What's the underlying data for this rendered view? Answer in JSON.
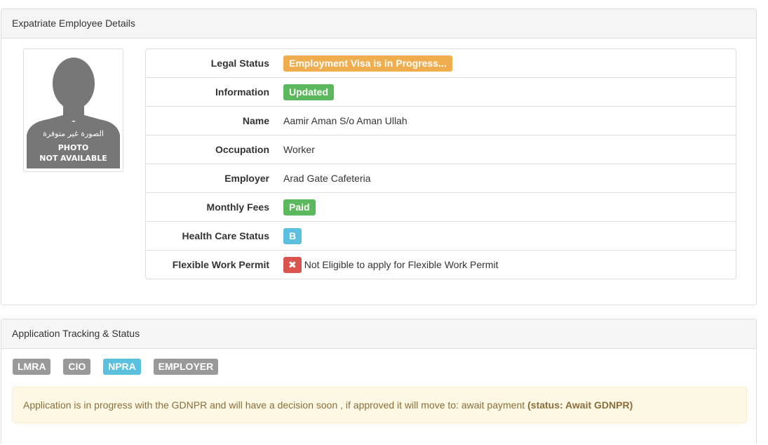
{
  "panel1": {
    "title": "Expatriate Employee Details",
    "photo": {
      "arabic_text": "الصورة غير متوفرة",
      "line1": "PHOTO",
      "line2": "NOT AVAILABLE"
    },
    "rows": [
      {
        "label": "Legal Status",
        "value": "Employment Visa is in Progress...",
        "style": "warning"
      },
      {
        "label": "Information",
        "value": "Updated",
        "style": "success"
      },
      {
        "label": "Name",
        "value": "Aamir Aman S/o Aman Ullah"
      },
      {
        "label": "Occupation",
        "value": "Worker"
      },
      {
        "label": "Employer",
        "value": "Arad Gate Cafeteria"
      },
      {
        "label": "Monthly Fees",
        "value": "Paid",
        "style": "success"
      },
      {
        "label": "Health Care Status",
        "value": "B",
        "style": "info"
      },
      {
        "label": "Flexible Work Permit",
        "icon": "✖",
        "value": "Not Eligible to apply for Flexible Work Permit"
      }
    ]
  },
  "panel2": {
    "title": "Application Tracking & Status",
    "stages": [
      "LMRA",
      "CIO",
      "NPRA",
      "EMPLOYER"
    ],
    "alert_text": "Application is in progress with the GDNPR and will have a decision soon , if approved it will move to: await payment",
    "alert_status": "(status: Await GDNPR)"
  },
  "colors": {
    "warning": "#f0ad4e",
    "success": "#5cb85c",
    "info": "#5bc0de",
    "danger": "#d9534f",
    "default": "#999999"
  },
  "icons": {
    "photo_placeholder": "person-silhouette-icon",
    "not_eligible": "times-icon"
  }
}
